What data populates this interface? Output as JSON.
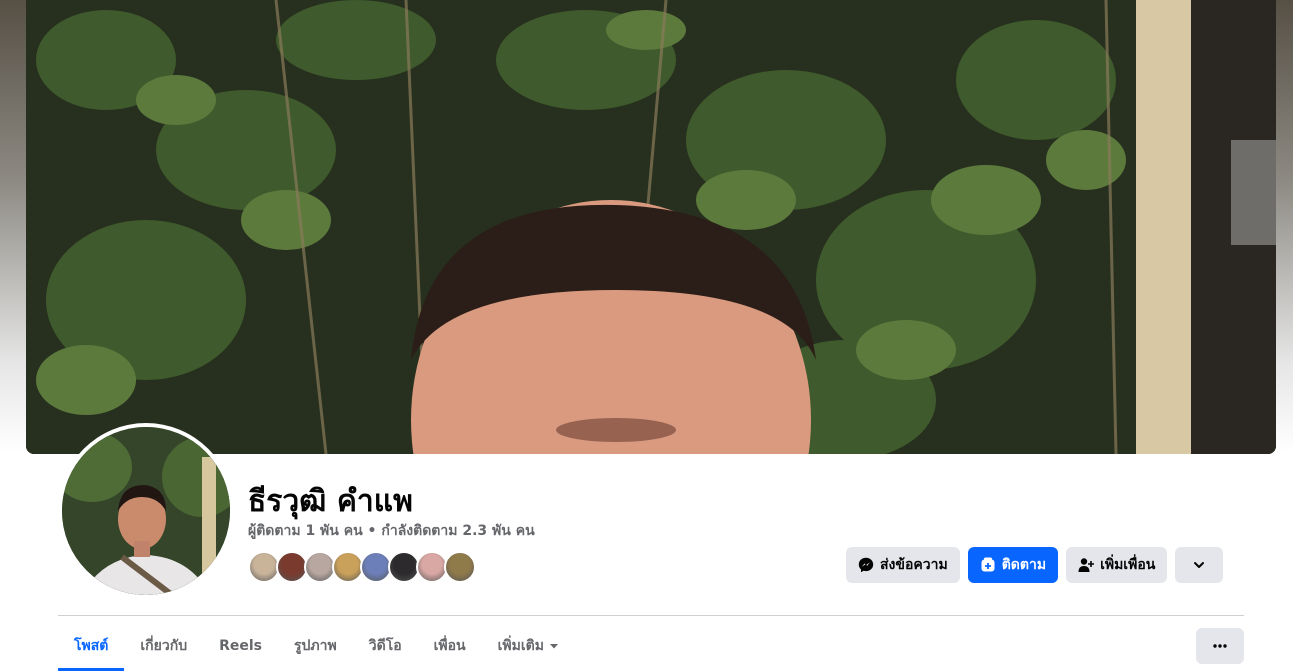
{
  "profile": {
    "name": "ธีรวุฒิ คำแพ",
    "stats": "ผู้ติดตาม 1 พัน คน • กำลังติดตาม 2.3 พัน คน"
  },
  "actions": {
    "message_label": "ส่งข้อความ",
    "follow_label": "ติดตาม",
    "add_friend_label": "เพิ่มเพื่อน",
    "more_icon": "chevron-down-icon"
  },
  "tabs": [
    {
      "label": "โพสต์",
      "active": true
    },
    {
      "label": "เกี่ยวกับ",
      "active": false
    },
    {
      "label": "Reels",
      "active": false
    },
    {
      "label": "รูปภาพ",
      "active": false
    },
    {
      "label": "วิดีโอ",
      "active": false
    },
    {
      "label": "เพื่อน",
      "active": false
    },
    {
      "label": "เพิ่มเติม",
      "active": false
    }
  ],
  "friend_faces": [
    "#c9b49a",
    "#7a3b2e",
    "#b8a7a0",
    "#caa15a",
    "#6c7fb8",
    "#2c2a2c",
    "#d9a7a4",
    "#8f7a4a"
  ],
  "colors": {
    "accent": "#0866ff",
    "button_grey": "#e4e6eb",
    "muted_text": "#65676b"
  }
}
